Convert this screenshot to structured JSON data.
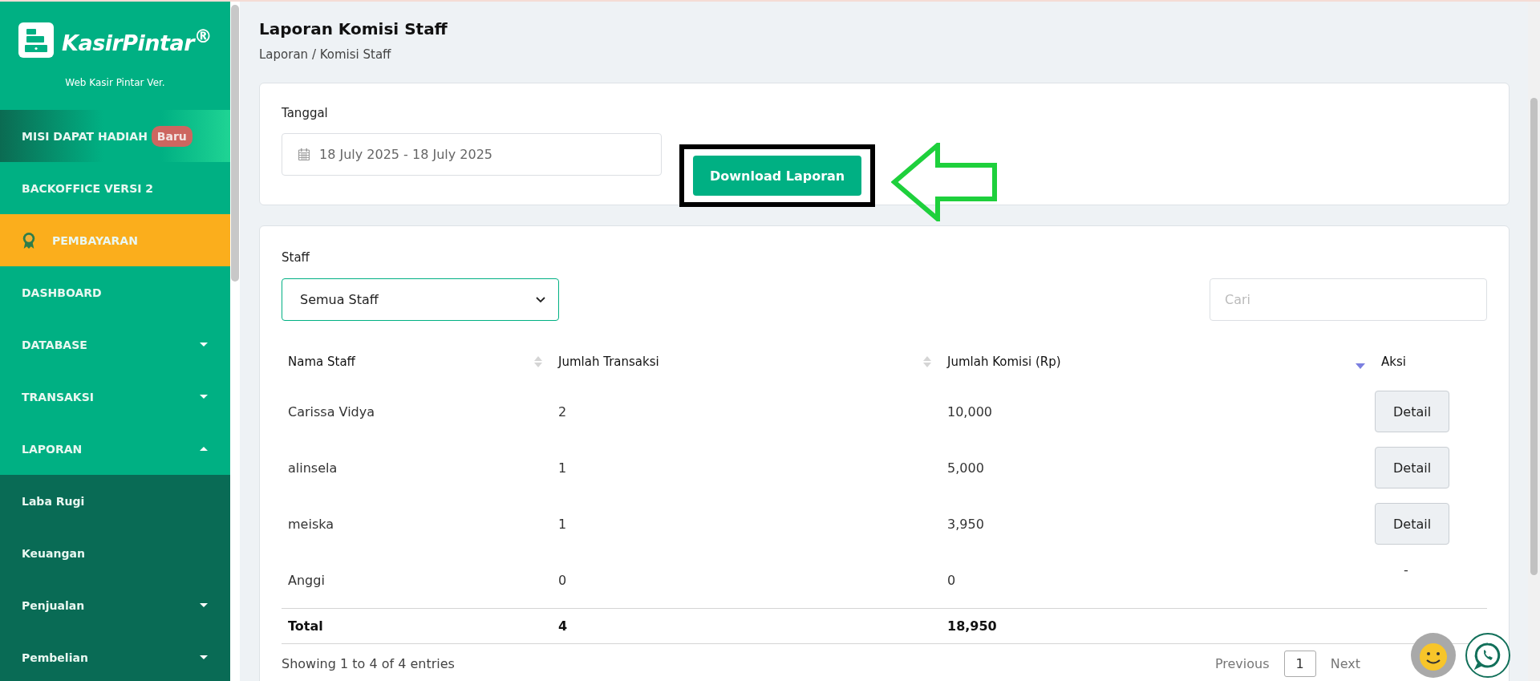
{
  "sidebar": {
    "logo": "KasirPintar$^{®}$",
    "version": "Web Kasir Pintar Ver.",
    "items": [
      {
        "label": "MISI DAPAT HADIAH",
        "kind": "promo",
        "badge": "Baru"
      },
      {
        "label": "BACKOFFICE VERSI 2",
        "kind": "plain"
      },
      {
        "label": "PEMBAYARAN",
        "kind": "payment"
      },
      {
        "label": "DASHBOARD",
        "kind": "plain"
      },
      {
        "label": "DATABASE",
        "kind": "group",
        "expanded": false
      },
      {
        "label": "TRANSAKSI",
        "kind": "group",
        "expanded": false
      },
      {
        "label": "LAPORAN",
        "kind": "group",
        "expanded": true,
        "children": [
          {
            "label": "Laba Rugi",
            "kind": "plain"
          },
          {
            "label": "Keuangan",
            "kind": "plain"
          },
          {
            "label": "Penjualan",
            "kind": "group",
            "expanded": false
          },
          {
            "label": "Pembelian",
            "kind": "group",
            "expanded": false
          }
        ]
      }
    ]
  },
  "page": {
    "title": "Laporan Komisi Staff",
    "breadcrumb": "Laporan / Komisi Staff"
  },
  "filter": {
    "label": "Tanggal",
    "date_range": "18 July 2025 - 18 July 2025",
    "download_button": "Download Laporan"
  },
  "staff": {
    "label": "Staff",
    "select_value": "Semua Staff",
    "search": {
      "placeholder": "Cari"
    }
  },
  "table": {
    "columns": [
      {
        "label": "Nama Staff",
        "sortable": true,
        "sorted": false
      },
      {
        "label": "Jumlah Transaksi",
        "sortable": true,
        "sorted": false
      },
      {
        "label": "Jumlah Komisi (Rp)",
        "sortable": true,
        "sorted": true
      },
      {
        "label": "Aksi",
        "sortable": false
      }
    ],
    "rows": [
      {
        "name": "Carissa Vidya",
        "transactions": "2",
        "commission": "10,000",
        "action": "Detail",
        "kind": "button"
      },
      {
        "name": "alinsela",
        "transactions": "1",
        "commission": "5,000",
        "action": "Detail",
        "kind": "button"
      },
      {
        "name": "meiska",
        "transactions": "1",
        "commission": "3,950",
        "action": "Detail",
        "kind": "button"
      },
      {
        "name": "Anggi",
        "transactions": "0",
        "commission": "0",
        "action": "-",
        "kind": "text"
      }
    ],
    "total": {
      "label": "Total",
      "transactions": "4",
      "commission": "18,950"
    }
  },
  "footer": {
    "info": "Showing 1 to 4 of 4 entries",
    "previous": "Previous",
    "page": "1",
    "next": "Next"
  }
}
